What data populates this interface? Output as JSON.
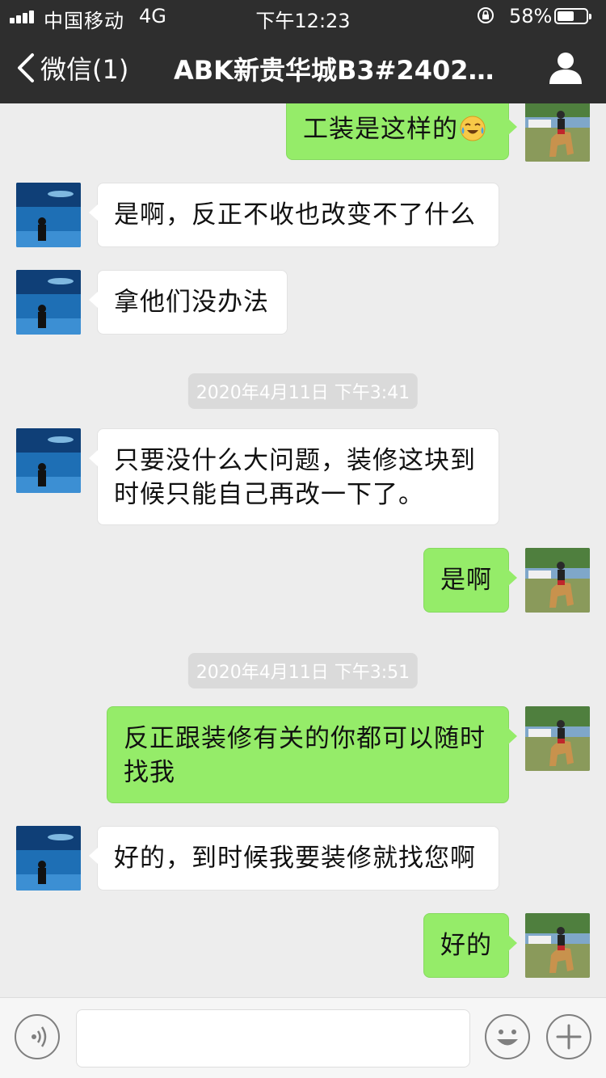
{
  "status_bar": {
    "carrier": "中国移动",
    "network": "4G",
    "time": "下午12:23",
    "battery_percent": "58%",
    "battery_level": 0.58
  },
  "nav": {
    "back_label": "微信(1)",
    "title": "ABK新贵华城B3#2402…",
    "icons": [
      "chevron-left-icon",
      "person-icon"
    ]
  },
  "messages": [
    {
      "type": "out",
      "text": "工装是这样的",
      "emoji": "crying-laughing"
    },
    {
      "type": "in",
      "text": "是啊，反正不收也改变不了什么"
    },
    {
      "type": "in",
      "text": "拿他们没办法"
    },
    {
      "type": "time",
      "text": "2020年4月11日 下午3:41"
    },
    {
      "type": "in",
      "text": "只要没什么大问题，装修这块到时候只能自己再改一下了。"
    },
    {
      "type": "out",
      "text": "是啊"
    },
    {
      "type": "time",
      "text": "2020年4月11日 下午3:51"
    },
    {
      "type": "out",
      "text": "反正跟装修有关的你都可以随时找我"
    },
    {
      "type": "in",
      "text": "好的，到时候我要装修就找您啊"
    },
    {
      "type": "out",
      "text": "好的"
    }
  ],
  "input_bar": {
    "value": "",
    "icons": [
      "voice-icon",
      "emoji-icon",
      "plus-icon"
    ]
  },
  "colors": {
    "header_bg": "#2e2e2e",
    "chat_bg": "#ededed",
    "outgoing_bubble": "#95ec69",
    "incoming_bubble": "#ffffff"
  }
}
